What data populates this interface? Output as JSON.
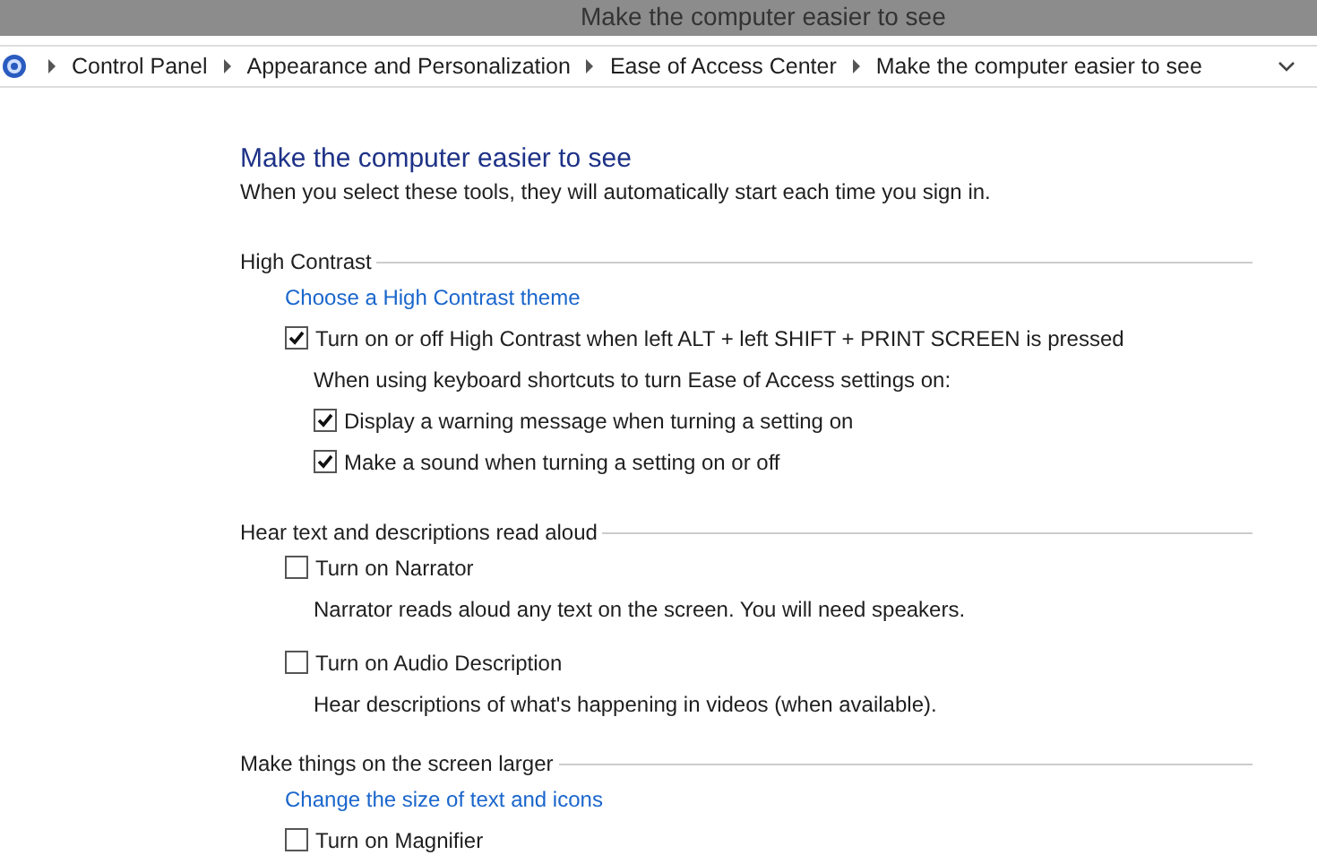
{
  "window": {
    "title": "Make the computer easier to see"
  },
  "breadcrumb": [
    "Control Panel",
    "Appearance and Personalization",
    "Ease of Access Center",
    "Make the computer easier to see"
  ],
  "heading": "Make the computer easier to see",
  "subtitle": "When you select these tools, they will automatically start each time you sign in.",
  "sections": [
    {
      "title": "High Contrast",
      "items": [
        {
          "kind": "link",
          "text": "Choose a High Contrast theme"
        },
        {
          "kind": "checkbox",
          "text": "Turn on or off High Contrast when left ALT + left SHIFT + PRINT SCREEN is pressed",
          "checked": true
        },
        {
          "kind": "note",
          "text": "When using keyboard shortcuts to turn Ease of Access settings on:"
        },
        {
          "kind": "subcheckbox",
          "text": "Display a warning message when turning a setting on",
          "checked": true
        },
        {
          "kind": "subcheckbox",
          "text": "Make a sound when turning a setting on or off",
          "checked": true
        }
      ]
    },
    {
      "title": "Hear text and descriptions read aloud",
      "items": [
        {
          "kind": "checkbox",
          "text": "Turn on Narrator",
          "checked": false
        },
        {
          "kind": "description",
          "text": "Narrator reads aloud any text on the screen. You will need speakers."
        },
        {
          "kind": "checkbox",
          "text": "Turn on Audio Description",
          "checked": false
        },
        {
          "kind": "description",
          "text": "Hear descriptions of what's happening in videos (when available)."
        }
      ]
    },
    {
      "title": "Make things on the screen larger",
      "items": [
        {
          "kind": "link",
          "text": "Change the size of text and icons"
        },
        {
          "kind": "checkbox",
          "text": "Turn on Magnifier",
          "checked": false
        }
      ]
    }
  ]
}
